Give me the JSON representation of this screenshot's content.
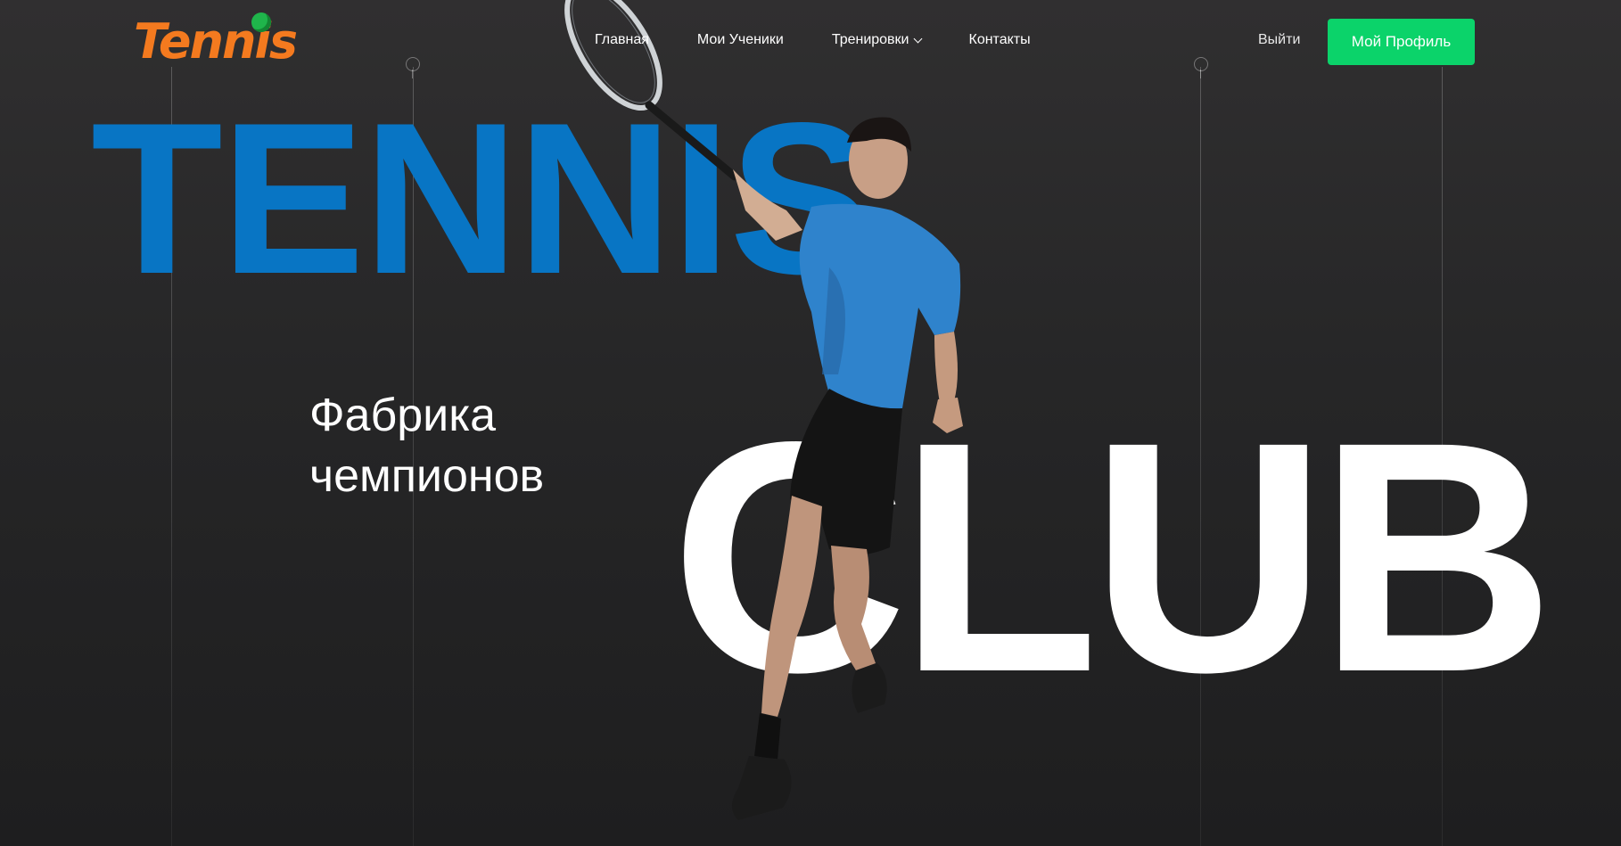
{
  "header": {
    "logo": {
      "text": "Tennis"
    },
    "nav": [
      {
        "label": "Главная"
      },
      {
        "label": "Мои Ученики"
      },
      {
        "label": "Тренировки"
      },
      {
        "label": "Контакты"
      }
    ],
    "logout_label": "Выйти",
    "profile_button_label": "Мой Профиль"
  },
  "hero": {
    "title_top": "TENNIS",
    "title_bottom": "CLUB",
    "slogan_line1": "Фабрика",
    "slogan_line2": "чемпионов"
  },
  "colors": {
    "background": "#262627",
    "accent_blue": "#0875c4",
    "accent_green": "#0bd36a",
    "logo_orange": "#f47a1f"
  }
}
